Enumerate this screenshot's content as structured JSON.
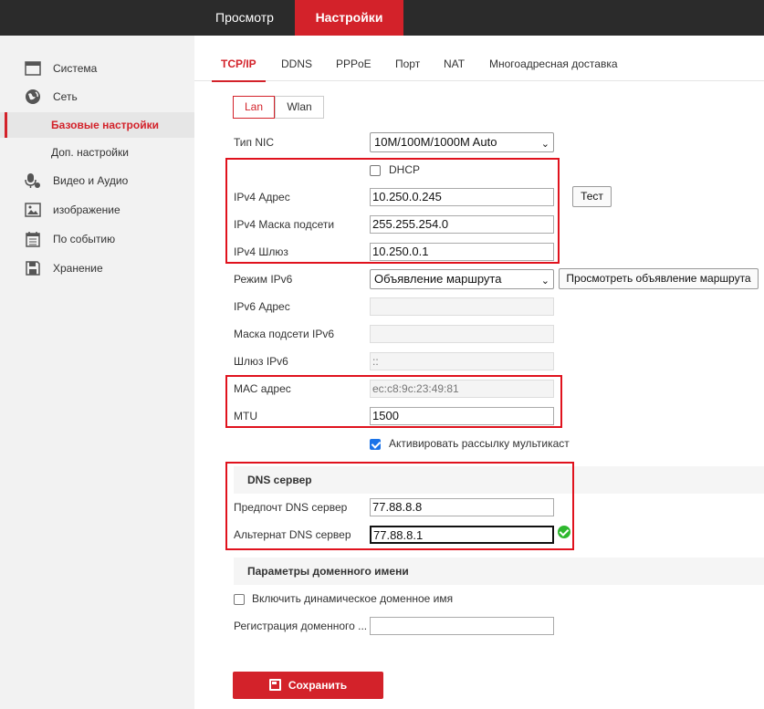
{
  "topnav": {
    "preview": "Просмотр",
    "settings": "Настройки"
  },
  "sidebar": {
    "items": [
      {
        "label": "Система",
        "icon": "system-icon"
      },
      {
        "label": "Сеть",
        "icon": "globe-icon"
      },
      {
        "label": "Видео и Аудио",
        "icon": "microphone-camera-icon"
      },
      {
        "label": "изображение",
        "icon": "image-icon"
      },
      {
        "label": "По событию",
        "icon": "calendar-icon"
      },
      {
        "label": "Хранение",
        "icon": "floppy-icon"
      }
    ],
    "subitems": [
      {
        "label": "Базовые настройки",
        "active": true
      },
      {
        "label": "Доп. настройки",
        "active": false
      }
    ]
  },
  "tabs": [
    "TCP/IP",
    "DDNS",
    "PPPoE",
    "Порт",
    "NAT",
    "Многоадресная доставка"
  ],
  "subtabs": [
    "Lan",
    "Wlan"
  ],
  "form": {
    "nic_type": {
      "label": "Тип NIC",
      "value": "10M/100M/1000M Auto"
    },
    "dhcp": {
      "label": "DHCP",
      "checked": false
    },
    "ipv4_address": {
      "label": "IPv4 Адрес",
      "value": "10.250.0.245"
    },
    "test_button": "Тест",
    "ipv4_mask": {
      "label": "IPv4 Маска подсети",
      "value": "255.255.254.0"
    },
    "ipv4_gateway": {
      "label": "IPv4 Шлюз",
      "value": "10.250.0.1"
    },
    "ipv6_mode": {
      "label": "Режим IPv6",
      "value": "Объявление маршрута"
    },
    "view_route_button": "Просмотреть объявление маршрута",
    "ipv6_address": {
      "label": "IPv6 Адрес",
      "value": ""
    },
    "ipv6_mask": {
      "label": "Маска подсети IPv6",
      "value": ""
    },
    "ipv6_gateway": {
      "label": "Шлюз IPv6",
      "value": "::"
    },
    "mac": {
      "label": "МАС адрес",
      "value": "ec:c8:9c:23:49:81"
    },
    "mtu": {
      "label": "MTU",
      "value": "1500"
    },
    "multicast": {
      "label": "Активировать рассылку мультикаст",
      "checked": true
    }
  },
  "dns": {
    "title": "DNS сервер",
    "preferred": {
      "label": "Предпочт DNS сервер",
      "value": "77.88.8.8"
    },
    "alternate": {
      "label": "Альтернат DNS сервер",
      "value": "77.88.8.1"
    }
  },
  "domain": {
    "title": "Параметры доменного имени",
    "dynamic": {
      "label": "Включить динамическое доменное имя",
      "checked": false
    },
    "registration": {
      "label": "Регистрация доменного ...",
      "value": ""
    }
  },
  "save_label": "Сохранить",
  "colors": {
    "accent": "#d3222a",
    "highlight": "#e0121d",
    "topbar": "#2b2b2b",
    "sidebar": "#f2f2f2"
  }
}
